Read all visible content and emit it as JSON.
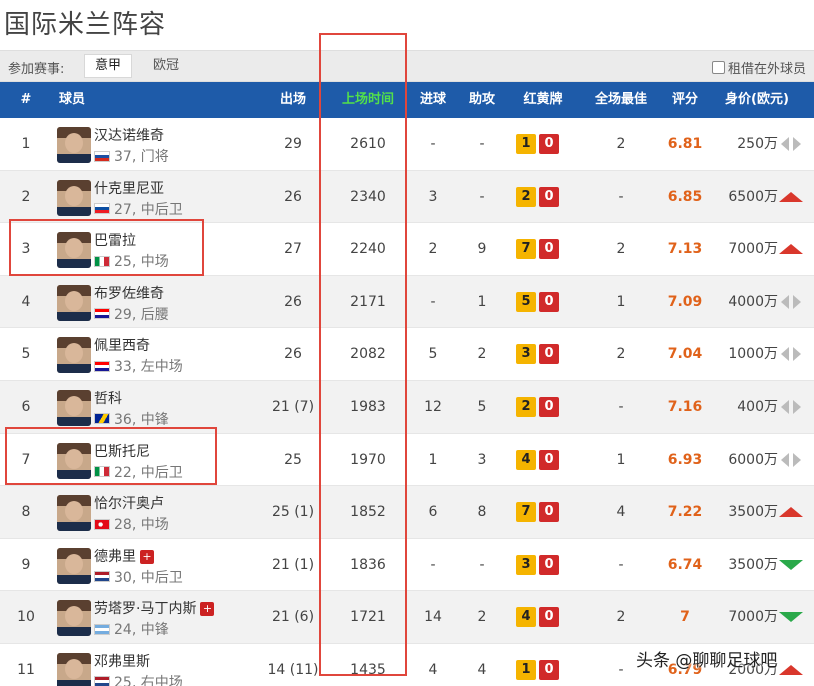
{
  "page": {
    "title": "国际米兰阵容"
  },
  "filter": {
    "label": "参加赛事:",
    "leagues": [
      "意甲",
      "欧冠"
    ],
    "active_index": 0,
    "loan_checkbox_label": "租借在外球员",
    "loan_checked": false
  },
  "table": {
    "headers": [
      "#",
      "球员",
      "出场",
      "上场时间",
      "进球",
      "助攻",
      "红黄牌",
      "全场最佳",
      "评分",
      "身价(欧元)"
    ],
    "highlight_header": "上场时间",
    "rows": [
      {
        "num": "1",
        "name": "汉达诺维奇",
        "info": "37, 门将",
        "flag": "slovenia",
        "apps": "29",
        "minutes": "2610",
        "goals": "-",
        "assists": "-",
        "yellow": "1",
        "red": "0",
        "motm": "2",
        "rating": "6.81",
        "value": "250万",
        "trend": "neutral",
        "injured": false
      },
      {
        "num": "2",
        "name": "什克里尼亚",
        "info": "27, 中后卫",
        "flag": "slovakia",
        "apps": "26",
        "minutes": "2340",
        "goals": "3",
        "assists": "-",
        "yellow": "2",
        "red": "0",
        "motm": "-",
        "rating": "6.85",
        "value": "6500万",
        "trend": "up",
        "injured": false
      },
      {
        "num": "3",
        "name": "巴雷拉",
        "info": "25, 中场",
        "flag": "italy",
        "apps": "27",
        "minutes": "2240",
        "goals": "2",
        "assists": "9",
        "yellow": "7",
        "red": "0",
        "motm": "2",
        "rating": "7.13",
        "value": "7000万",
        "trend": "up",
        "injured": false
      },
      {
        "num": "4",
        "name": "布罗佐维奇",
        "info": "29, 后腰",
        "flag": "croatia",
        "apps": "26",
        "minutes": "2171",
        "goals": "-",
        "assists": "1",
        "yellow": "5",
        "red": "0",
        "motm": "1",
        "rating": "7.09",
        "value": "4000万",
        "trend": "neutral",
        "injured": false
      },
      {
        "num": "5",
        "name": "佩里西奇",
        "info": "33, 左中场",
        "flag": "croatia",
        "apps": "26",
        "minutes": "2082",
        "goals": "5",
        "assists": "2",
        "yellow": "3",
        "red": "0",
        "motm": "2",
        "rating": "7.04",
        "value": "1000万",
        "trend": "neutral",
        "injured": false
      },
      {
        "num": "6",
        "name": "哲科",
        "info": "36, 中锋",
        "flag": "bosnia",
        "apps": "21 (7)",
        "minutes": "1983",
        "goals": "12",
        "assists": "5",
        "yellow": "2",
        "red": "0",
        "motm": "-",
        "rating": "7.16",
        "value": "400万",
        "trend": "neutral",
        "injured": false
      },
      {
        "num": "7",
        "name": "巴斯托尼",
        "info": "22, 中后卫",
        "flag": "italy",
        "apps": "25",
        "minutes": "1970",
        "goals": "1",
        "assists": "3",
        "yellow": "4",
        "red": "0",
        "motm": "1",
        "rating": "6.93",
        "value": "6000万",
        "trend": "neutral",
        "injured": false
      },
      {
        "num": "8",
        "name": "恰尔汗奥卢",
        "info": "28, 中场",
        "flag": "turkey",
        "apps": "25 (1)",
        "minutes": "1852",
        "goals": "6",
        "assists": "8",
        "yellow": "7",
        "red": "0",
        "motm": "4",
        "rating": "7.22",
        "value": "3500万",
        "trend": "up",
        "injured": false
      },
      {
        "num": "9",
        "name": "德弗里",
        "info": "30, 中后卫",
        "flag": "netherlands",
        "apps": "21 (1)",
        "minutes": "1836",
        "goals": "-",
        "assists": "-",
        "yellow": "3",
        "red": "0",
        "motm": "-",
        "rating": "6.74",
        "value": "3500万",
        "trend": "down",
        "injured": true
      },
      {
        "num": "10",
        "name": "劳塔罗·马丁内斯",
        "info": "24, 中锋",
        "flag": "argentina",
        "apps": "21 (6)",
        "minutes": "1721",
        "goals": "14",
        "assists": "2",
        "yellow": "4",
        "red": "0",
        "motm": "2",
        "rating": "7",
        "value": "7000万",
        "trend": "down",
        "injured": true
      },
      {
        "num": "11",
        "name": "邓弗里斯",
        "info": "25, 右中场",
        "flag": "netherlands",
        "apps": "14 (11)",
        "minutes": "1435",
        "goals": "4",
        "assists": "4",
        "yellow": "1",
        "red": "0",
        "motm": "-",
        "rating": "6.79",
        "value": "2000万",
        "trend": "up",
        "injured": false
      }
    ]
  },
  "watermark": "头条 @聊聊足球吧",
  "colors": {
    "header_bg": "#1e5ba9",
    "highlight_header": "#53e04a",
    "rating": "#e0621a",
    "yellow_card": "#f5b400",
    "red_card": "#d12a2a",
    "trend_up": "#d9372c",
    "trend_down": "#2aa94a",
    "trend_neutral": "#bbbbbb",
    "annotation_box": "#e0463c"
  }
}
